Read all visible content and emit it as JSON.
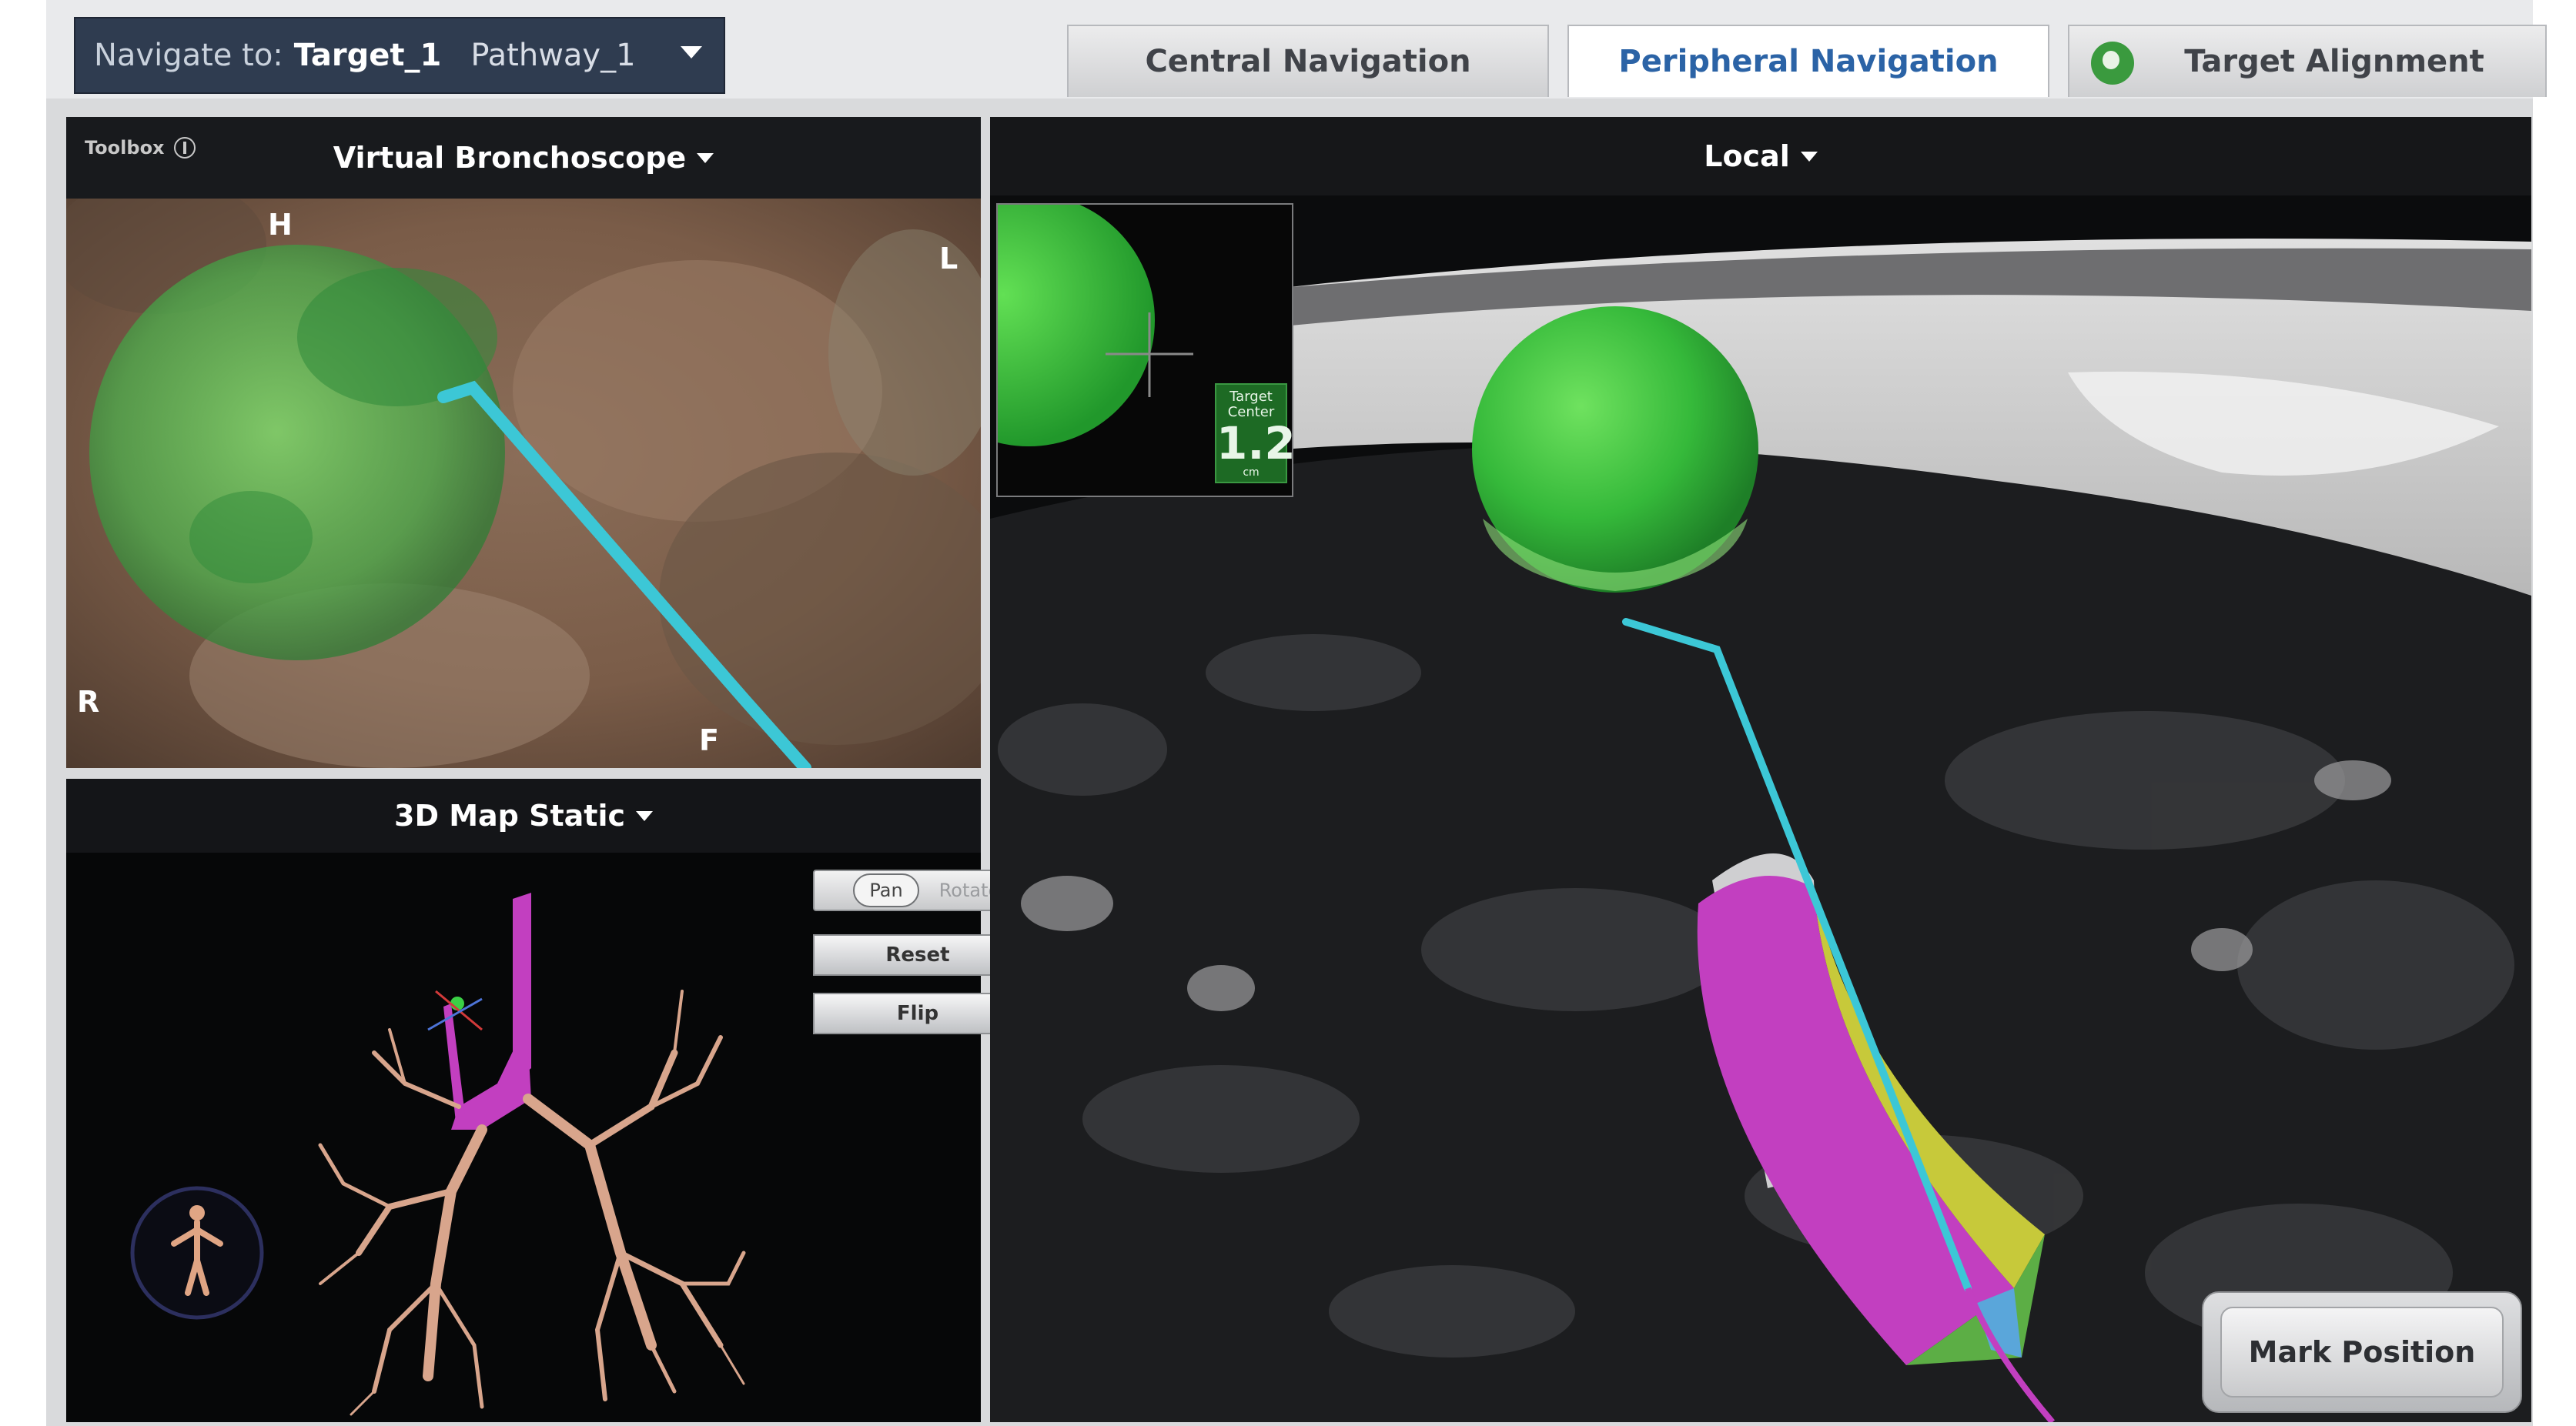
{
  "navigate": {
    "label": "Navigate to:",
    "target": "Target_1",
    "pathway": "Pathway_1"
  },
  "tabs": [
    {
      "label": "Central Navigation",
      "active": false
    },
    {
      "label": "Peripheral Navigation",
      "active": true
    },
    {
      "label": "Target Alignment",
      "active": false,
      "icon": "target-alignment-icon"
    }
  ],
  "virtual_bronchoscope": {
    "toolbox_label": "Toolbox",
    "title": "Virtual Bronchoscope",
    "orientation": {
      "head": "H",
      "left": "L",
      "right": "R",
      "foot": "F"
    }
  },
  "map": {
    "title": "3D Map Static",
    "pan_label": "Pan",
    "rotate_label": "Rotate",
    "reset_label": "Reset",
    "flip_label": "Flip"
  },
  "local": {
    "title": "Local",
    "target_center_label": "Target Center",
    "target_center_value": "1.2",
    "target_center_unit": "cm",
    "mark_position_label": "Mark Position"
  },
  "colors": {
    "target": "#34b83a",
    "catheter": "#3cc7d6",
    "pathway": "#c23fc0",
    "accent": "#2b63a6",
    "selector_bg": "#2f3c50"
  }
}
